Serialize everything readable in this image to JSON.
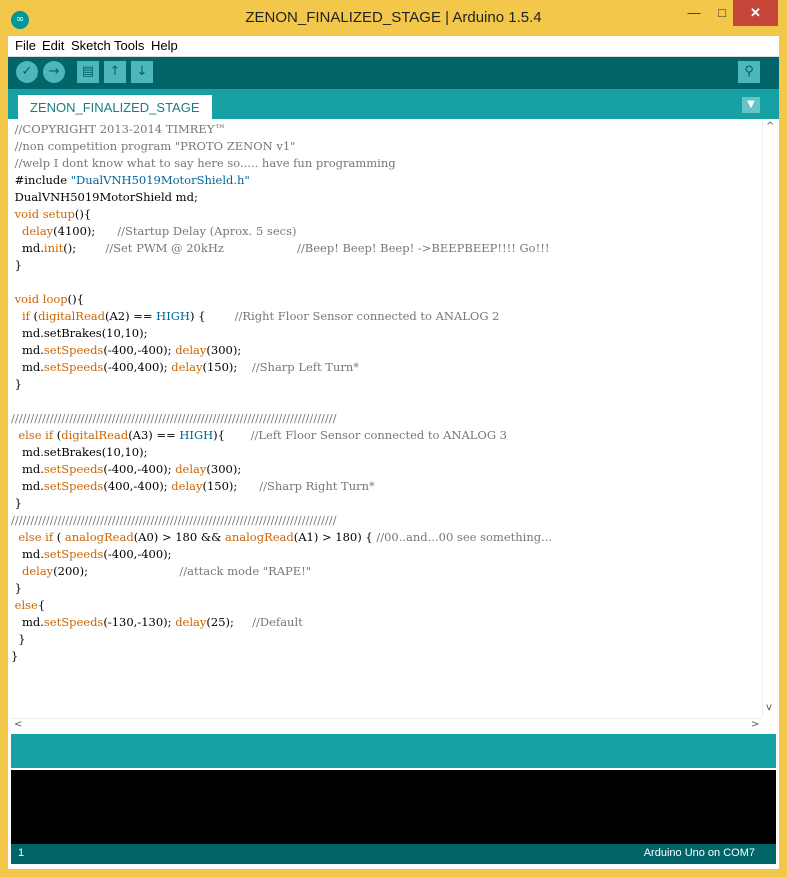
{
  "window": {
    "title": "ZENON_FINALIZED_STAGE | Arduino 1.5.4",
    "app_icon": "∞",
    "minimize": "—",
    "maximize": "□",
    "close": "✕"
  },
  "menu": [
    "File",
    "Edit",
    "Sketch",
    "Tools",
    "Help"
  ],
  "toolbar": {
    "verify": "✓",
    "upload": "→",
    "new": "▤",
    "open": "↑",
    "save": "↓",
    "serial_monitor": "⚲"
  },
  "tabs": [
    {
      "label": "ZENON_FINALIZED_STAGE"
    }
  ],
  "tab_menu": "▼",
  "code_colors": {
    "comment": "#777777",
    "function": "#cc6600",
    "constant": "#006699",
    "string": "#006699"
  },
  "code_lines": [
    [
      {
        "t": " //COPYRIGHT 2013-2014 TIMREY™",
        "c": "comment"
      }
    ],
    [
      {
        "t": " //non competition program \"PROTO ZENON v1\"",
        "c": "comment"
      }
    ],
    [
      {
        "t": " //welp I dont know what to say here so..... have fun programming",
        "c": "comment"
      }
    ],
    [
      {
        "t": " #include "
      },
      {
        "t": "\"DualVNH5019MotorShield.h\"",
        "c": "string"
      }
    ],
    [
      {
        "t": " DualVNH5019MotorShield md;"
      }
    ],
    [
      {
        "t": " "
      },
      {
        "t": "void",
        "c": "function"
      },
      {
        "t": " "
      },
      {
        "t": "setup",
        "c": "function"
      },
      {
        "t": "(){"
      }
    ],
    [
      {
        "t": "   "
      },
      {
        "t": "delay",
        "c": "function"
      },
      {
        "t": "(4100);      "
      },
      {
        "t": "//Startup Delay (Aprox. 5 secs)",
        "c": "comment"
      }
    ],
    [
      {
        "t": "   md."
      },
      {
        "t": "init",
        "c": "function"
      },
      {
        "t": "();        "
      },
      {
        "t": "//Set PWM @ 20kHz                    //Beep! Beep! Beep! ->BEEPBEEP!!!! Go!!!",
        "c": "comment"
      }
    ],
    [
      {
        "t": " }"
      }
    ],
    [
      {
        "t": ""
      }
    ],
    [
      {
        "t": " "
      },
      {
        "t": "void",
        "c": "function"
      },
      {
        "t": " "
      },
      {
        "t": "loop",
        "c": "function"
      },
      {
        "t": "(){"
      }
    ],
    [
      {
        "t": "   "
      },
      {
        "t": "if",
        "c": "function"
      },
      {
        "t": " ("
      },
      {
        "t": "digitalRead",
        "c": "function"
      },
      {
        "t": "(A2) == "
      },
      {
        "t": "HIGH",
        "c": "constant"
      },
      {
        "t": ") {        "
      },
      {
        "t": "//Right Floor Sensor connected to ANALOG 2",
        "c": "comment"
      }
    ],
    [
      {
        "t": "   md.setBrakes(10,10);"
      }
    ],
    [
      {
        "t": "   md."
      },
      {
        "t": "setSpeeds",
        "c": "function"
      },
      {
        "t": "(-400,-400); "
      },
      {
        "t": "delay",
        "c": "function"
      },
      {
        "t": "(300);"
      }
    ],
    [
      {
        "t": "   md."
      },
      {
        "t": "setSpeeds",
        "c": "function"
      },
      {
        "t": "(-400,400); "
      },
      {
        "t": "delay",
        "c": "function"
      },
      {
        "t": "(150);    "
      },
      {
        "t": "//Sharp Left Turn*",
        "c": "comment"
      }
    ],
    [
      {
        "t": " }"
      }
    ],
    [
      {
        "t": ""
      }
    ],
    [
      {
        "t": "////////////////////////////////////////////////////////////////////////////////////",
        "c": "comment"
      }
    ],
    [
      {
        "t": "  "
      },
      {
        "t": "else",
        "c": "function"
      },
      {
        "t": " "
      },
      {
        "t": "if",
        "c": "function"
      },
      {
        "t": " ("
      },
      {
        "t": "digitalRead",
        "c": "function"
      },
      {
        "t": "(A3) == "
      },
      {
        "t": "HIGH",
        "c": "constant"
      },
      {
        "t": "){       "
      },
      {
        "t": "//Left Floor Sensor connected to ANALOG 3",
        "c": "comment"
      }
    ],
    [
      {
        "t": "   md.setBrakes(10,10);"
      }
    ],
    [
      {
        "t": "   md."
      },
      {
        "t": "setSpeeds",
        "c": "function"
      },
      {
        "t": "(-400,-400); "
      },
      {
        "t": "delay",
        "c": "function"
      },
      {
        "t": "(300);"
      }
    ],
    [
      {
        "t": "   md."
      },
      {
        "t": "setSpeeds",
        "c": "function"
      },
      {
        "t": "(400,-400); "
      },
      {
        "t": "delay",
        "c": "function"
      },
      {
        "t": "(150);      "
      },
      {
        "t": "//Sharp Right Turn*",
        "c": "comment"
      }
    ],
    [
      {
        "t": " }"
      }
    ],
    [
      {
        "t": "////////////////////////////////////////////////////////////////////////////////////",
        "c": "comment"
      }
    ],
    [
      {
        "t": "  "
      },
      {
        "t": "else",
        "c": "function"
      },
      {
        "t": " "
      },
      {
        "t": "if",
        "c": "function"
      },
      {
        "t": " ( "
      },
      {
        "t": "analogRead",
        "c": "function"
      },
      {
        "t": "(A0) > 180 && "
      },
      {
        "t": "analogRead",
        "c": "function"
      },
      {
        "t": "(A1) > 180) { "
      },
      {
        "t": "//00..and...00 see something...",
        "c": "comment"
      }
    ],
    [
      {
        "t": "   md."
      },
      {
        "t": "setSpeeds",
        "c": "function"
      },
      {
        "t": "(-400,-400);"
      }
    ],
    [
      {
        "t": "   "
      },
      {
        "t": "delay",
        "c": "function"
      },
      {
        "t": "(200);                         "
      },
      {
        "t": "//attack mode \"RAPE!\"",
        "c": "comment"
      }
    ],
    [
      {
        "t": " }"
      }
    ],
    [
      {
        "t": " "
      },
      {
        "t": "else",
        "c": "function"
      },
      {
        "t": "{"
      }
    ],
    [
      {
        "t": "   md."
      },
      {
        "t": "setSpeeds",
        "c": "function"
      },
      {
        "t": "(-130,-130); "
      },
      {
        "t": "delay",
        "c": "function"
      },
      {
        "t": "(25);     "
      },
      {
        "t": "//Default",
        "c": "comment"
      }
    ],
    [
      {
        "t": "  }"
      }
    ],
    [
      {
        "t": "}"
      }
    ]
  ],
  "scroll": {
    "up": "^",
    "down": "v",
    "left": "<",
    "right": ">"
  },
  "status": {
    "line": "1",
    "board": "Arduino Uno on COM7"
  }
}
